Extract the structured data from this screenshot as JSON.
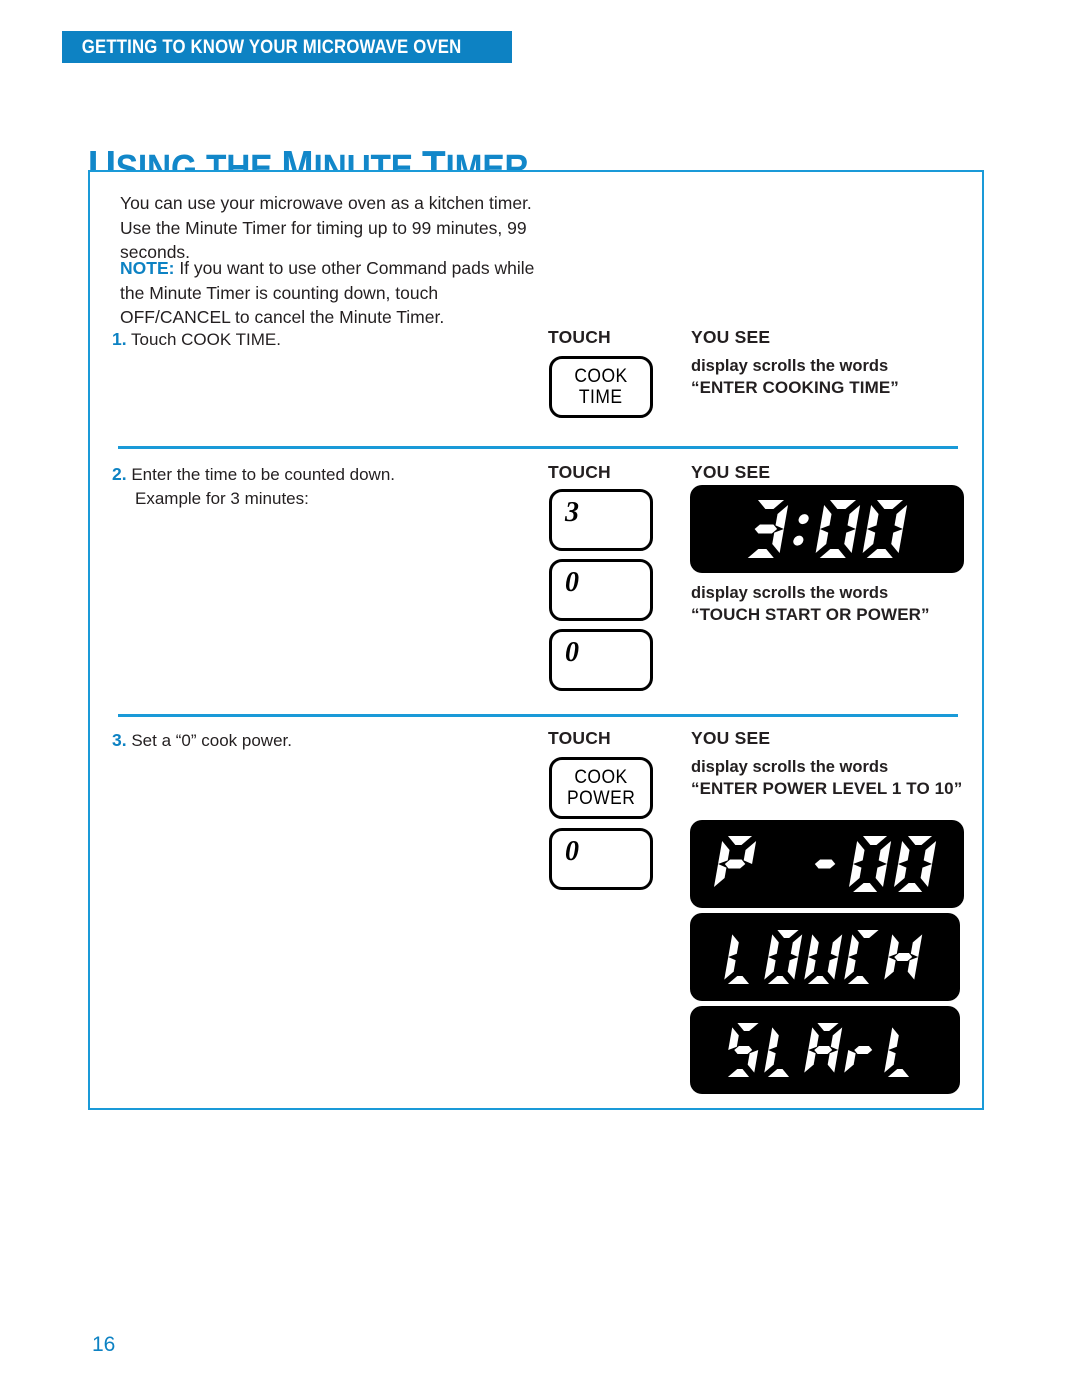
{
  "running_head": "GETTING TO KNOW YOUR MICROWAVE OVEN",
  "section_title": {
    "cap1": "U",
    "rest1": "SING THE ",
    "cap2": "M",
    "rest2": "INUTE ",
    "cap3": "T",
    "rest3": "IMER",
    "full": "USING THE MINUTE TIMER"
  },
  "intro": {
    "paragraph1": "You can use your microwave oven as a kitchen timer. Use the Minute Timer for timing up to 99 minutes, 99 seconds.",
    "note_label": "NOTE:",
    "note_body": " If you want to use other Command pads while the Minute Timer is counting down, touch OFF/CANCEL to cancel the Minute Timer."
  },
  "columns": {
    "touch": "TOUCH",
    "you_see": "YOU SEE"
  },
  "steps": [
    {
      "number": "1.",
      "text": "Touch COOK TIME.",
      "text2": "",
      "keys": [
        {
          "type": "word",
          "line1": "COOK",
          "line2": "TIME"
        }
      ],
      "see": [
        {
          "line1": "display scrolls the words",
          "line2": "“ENTER COOKING TIME”"
        }
      ],
      "displays": []
    },
    {
      "number": "2.",
      "text": "Enter the time to be counted down.",
      "text2": "Example for 3 minutes:",
      "keys": [
        {
          "type": "num",
          "value": "3"
        },
        {
          "type": "num",
          "value": "0"
        },
        {
          "type": "num",
          "value": "0"
        }
      ],
      "see": [
        {
          "line1": "display scrolls the words",
          "line2": "“TOUCH START OR POWER”"
        }
      ],
      "displays": [
        {
          "value": "3:00"
        }
      ]
    },
    {
      "number": "3.",
      "text": "Set a “0” cook power.",
      "text2": "",
      "keys": [
        {
          "type": "word",
          "line1": "COOK",
          "line2": "POWER"
        },
        {
          "type": "num",
          "value": "0"
        }
      ],
      "see": [
        {
          "line1": "display scrolls the words",
          "line2": "“ENTER POWER LEVEL 1 TO 10”"
        }
      ],
      "displays": [
        {
          "value": "P -00"
        },
        {
          "value": "TOUCH"
        },
        {
          "value": "START"
        }
      ]
    }
  ],
  "page_number": "16",
  "colors": {
    "brand_blue": "#0d82c3",
    "border_blue": "#1a9ad8",
    "title_blue": "#1287c9",
    "body_text": "#231f20",
    "lcd_background": "#000000",
    "lcd_segment": "#ffffff"
  }
}
